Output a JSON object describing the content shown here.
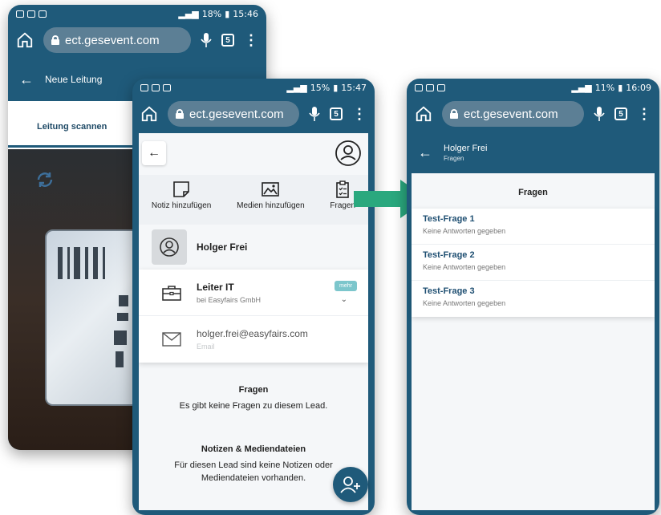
{
  "phone1": {
    "status": {
      "signal": "18%",
      "time": "15:46"
    },
    "url": "ect.gesevent.com",
    "tabs_count": "5",
    "page_title": "Neue Leitung",
    "tab_label": "Leitung scannen"
  },
  "phone2": {
    "status": {
      "signal": "15%",
      "time": "15:47"
    },
    "url": "ect.gesevent.com",
    "tabs_count": "5",
    "actions": [
      {
        "label": "Notiz hinzufügen",
        "icon": "note-icon"
      },
      {
        "label": "Medien hinzufügen",
        "icon": "image-icon"
      },
      {
        "label": "Fragen",
        "icon": "clipboard-icon"
      }
    ],
    "contact_name": "Holger Frei",
    "job_title": "Leiter IT",
    "company": "bei Easyfairs GmbH",
    "more_label": "mehr",
    "email": "holger.frei@easyfairs.com",
    "email_label": "Email",
    "questions_title": "Fragen",
    "questions_empty": "Es gibt keine Fragen zu diesem Lead.",
    "notes_title": "Notizen & Mediendateien",
    "notes_empty": "Für diesen Lead sind keine Notizen oder Mediendateien vorhanden."
  },
  "phone3": {
    "status": {
      "signal": "11%",
      "time": "16:09"
    },
    "url": "ect.gesevent.com",
    "tabs_count": "5",
    "header_title": "Holger Frei",
    "header_sub": "Fragen",
    "list_title": "Fragen",
    "questions": [
      {
        "title": "Test-Frage 1",
        "sub": "Keine Antworten gegeben"
      },
      {
        "title": "Test-Frage 2",
        "sub": "Keine Antworten gegeben"
      },
      {
        "title": "Test-Frage 3",
        "sub": "Keine Antworten gegeben"
      }
    ]
  },
  "colors": {
    "primary": "#1f5a7a",
    "arrow": "#2aa87e",
    "badge": "#7cc6cc"
  }
}
